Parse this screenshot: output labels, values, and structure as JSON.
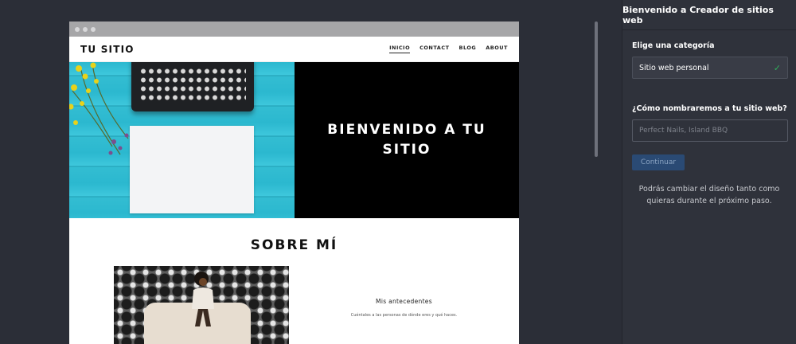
{
  "site": {
    "logo": "TU SITIO",
    "nav": [
      {
        "label": "INICIO",
        "active": true
      },
      {
        "label": "CONTACT",
        "active": false
      },
      {
        "label": "BLOG",
        "active": false
      },
      {
        "label": "ABOUT",
        "active": false
      }
    ],
    "hero_title": "BIENVENIDO A TU SITIO",
    "about_title": "SOBRE MÍ",
    "about_heading": "Mis antecedentes",
    "about_text": "Cuéntales a las personas de dónde eres y qué haces."
  },
  "panel": {
    "title": "Bienvenido a Creador de sitios web",
    "category_label": "Elige una categoría",
    "category_value": "Sitio web personal",
    "name_label": "¿Cómo nombraremos a tu sitio web?",
    "name_placeholder": "Perfect Nails, Island BBQ",
    "continue_label": "Continuar",
    "note": "Podrás cambiar el diseño tanto como quieras durante el próximo paso."
  },
  "colors": {
    "background": "#2b2e37",
    "panel": "#2f323b",
    "accent_button": "#2a4a74",
    "check": "#30b05c"
  }
}
